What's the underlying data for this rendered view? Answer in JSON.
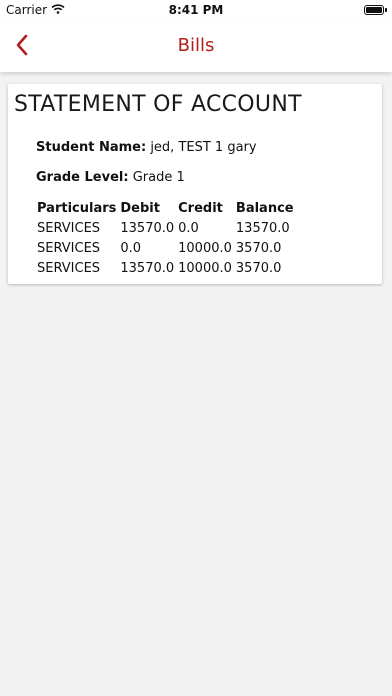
{
  "status_bar": {
    "carrier": "Carrier",
    "time": "8:41 PM"
  },
  "nav": {
    "title": "Bills",
    "accent_color": "#b21e1e"
  },
  "statement": {
    "title": "STATEMENT OF ACCOUNT",
    "student_label": "Student Name:",
    "student_value": "jed, TEST 1 gary",
    "grade_label": "Grade Level:",
    "grade_value": "Grade 1",
    "columns": [
      "Particulars",
      "Debit",
      "Credit",
      "Balance"
    ],
    "rows": [
      [
        "SERVICES",
        "13570.0",
        "0.0",
        "13570.0"
      ],
      [
        "SERVICES",
        "0.0",
        "10000.0",
        "3570.0"
      ],
      [
        "SERVICES",
        "13570.0",
        "10000.0",
        "3570.0"
      ]
    ]
  }
}
